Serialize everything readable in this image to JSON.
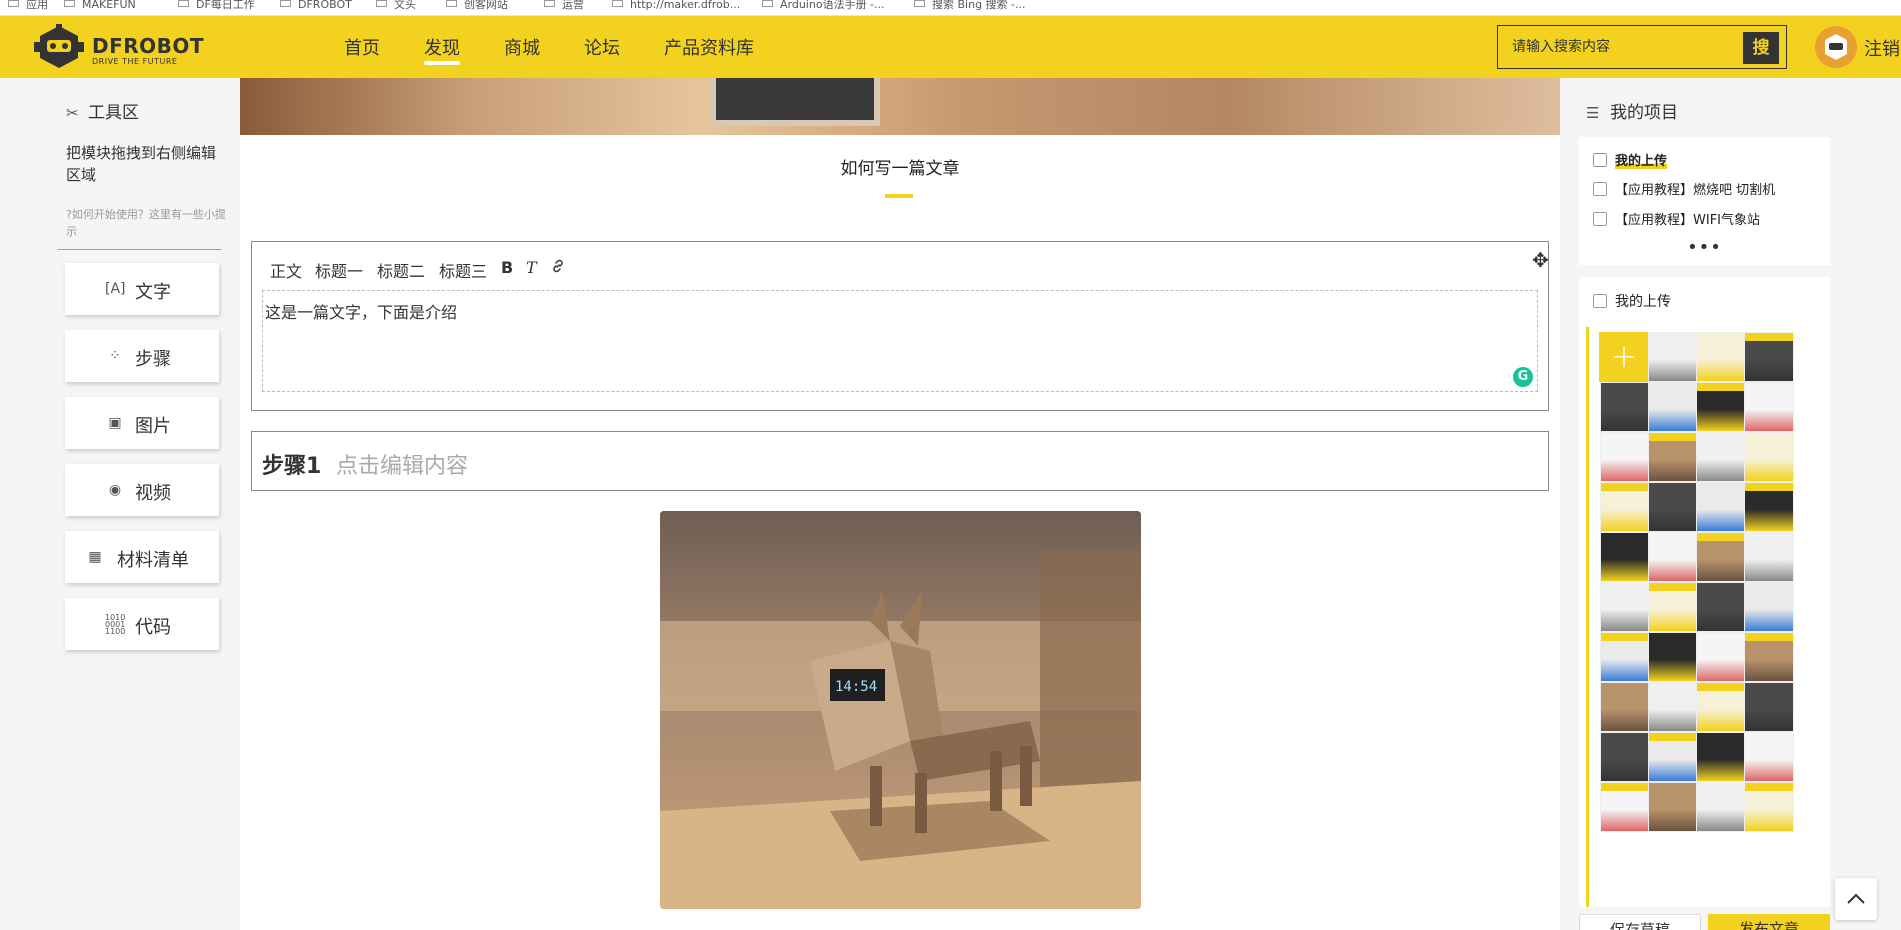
{
  "bookmarks": {
    "items": [
      "应用",
      "MAKEFUN",
      "DF每日工作",
      "DFROBOT",
      "文头",
      "创客网站",
      "运营",
      "http://maker.dfrob...",
      "Arduino语法手册 -...",
      "搜索 Bing 搜索 -..."
    ]
  },
  "header": {
    "logo": "DFROBOT",
    "logo_tagline": "DRIVE THE FUTURE",
    "nav": [
      "首页",
      "发现",
      "商城",
      "论坛",
      "产品资料库"
    ],
    "active_nav": "发现",
    "search_placeholder": "请输入搜索内容",
    "search_button": "搜",
    "logout": "注销"
  },
  "toolbox": {
    "title": "工具区",
    "hint": "把模块拖拽到右侧编辑区域",
    "tip": "?如何开始使用？这里有一些小提示",
    "tools": [
      {
        "label": "文字",
        "icon": "text-icon"
      },
      {
        "label": "步骤",
        "icon": "steps-icon"
      },
      {
        "label": "图片",
        "icon": "image-icon"
      },
      {
        "label": "视频",
        "icon": "video-icon"
      },
      {
        "label": "材料清单",
        "icon": "chip-icon"
      },
      {
        "label": "代码",
        "icon": "code-icon"
      }
    ]
  },
  "article": {
    "title": "如何写一篇文章",
    "toolbar": [
      "正文",
      "标题一",
      "标题二",
      "标题三",
      "B",
      "T"
    ],
    "body_text": "这是一篇文字，下面是介绍",
    "step_label": "步骤1",
    "step_placeholder": "点击编辑内容"
  },
  "projects": {
    "title": "我的项目",
    "items": [
      "我的上传",
      "【应用教程】燃烧吧 切割机",
      "【应用教程】WIFI气象站"
    ],
    "more": "•••",
    "uploads_title": "我的上传",
    "add_label": "+",
    "save_draft": "保存草稿",
    "publish": "发布文章"
  },
  "colors": {
    "brand_yellow": "#f2d21f",
    "dark": "#333333"
  }
}
